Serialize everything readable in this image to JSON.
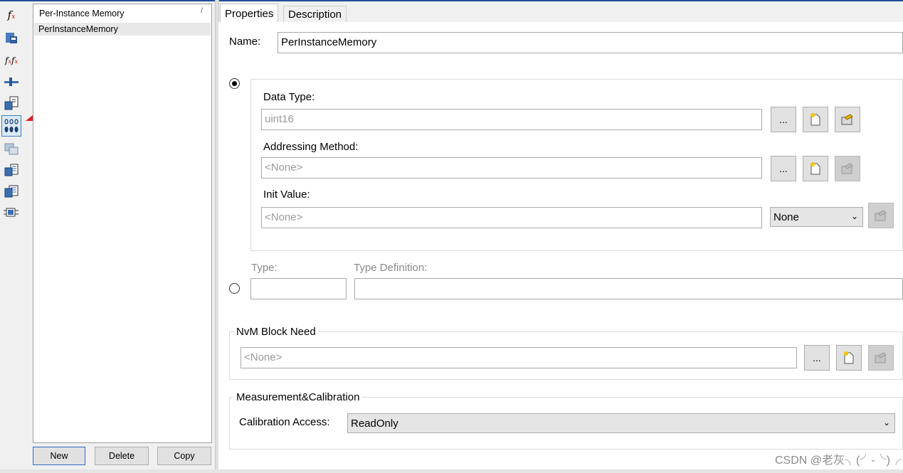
{
  "icons": [
    "fx-icon",
    "save-data-icon",
    "fx-chain-icon",
    "port-connector-icon",
    "calc-document-icon",
    "per-instance-memory-icon",
    "component-group-icon",
    "runnable-list-icon",
    "event-list-icon",
    "interface-icon"
  ],
  "list": {
    "header": "Per-Instance Memory",
    "header_mark": "/",
    "items": [
      "PerInstanceMemory"
    ],
    "buttons": {
      "new": "New",
      "delete": "Delete",
      "copy": "Copy"
    }
  },
  "tabs": {
    "properties": "Properties",
    "description": "Description"
  },
  "form": {
    "name_label": "Name:",
    "name_value": "PerInstanceMemory",
    "data_type_label": "Data Type:",
    "data_type_value": "uint16",
    "addressing_label": "Addressing Method:",
    "addressing_value": "<None>",
    "init_label": "Init Value:",
    "init_value": "<None>",
    "init_combo": "None",
    "browse_label": "...",
    "type_label": "Type:",
    "type_def_label": "Type Definition:",
    "nvm_legend": "NvM Block Need",
    "nvm_value": "<None>",
    "mc_legend": "Measurement&Calibration",
    "calib_label": "Calibration Access:",
    "calib_value": "ReadOnly"
  },
  "watermark": "CSDN @老灰╮(╯-╰)╭",
  "accent_color": "#1f4e9b"
}
